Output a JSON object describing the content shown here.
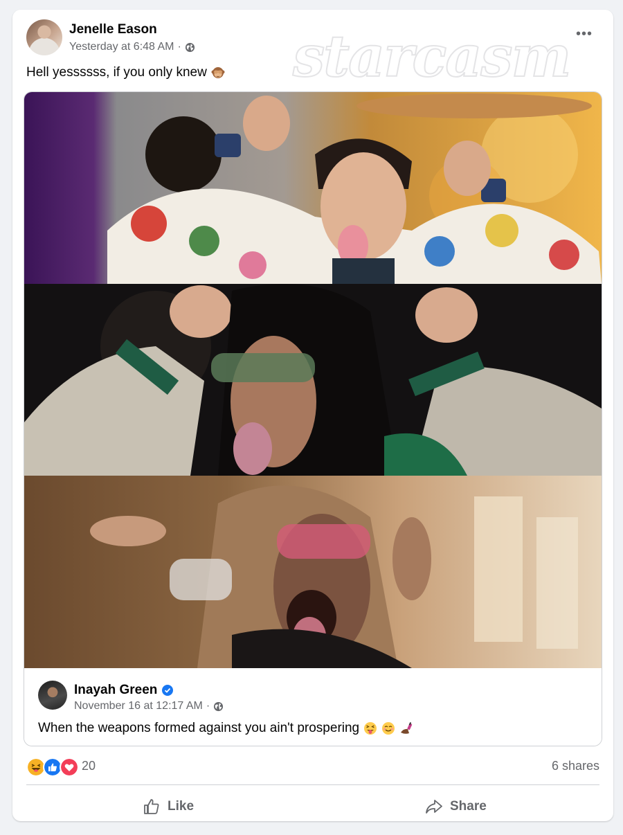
{
  "post": {
    "author": "Jenelle Eason",
    "timestamp": "Yesterday at 6:48 AM",
    "privacy_icon": "globe-icon",
    "more_label": "•••",
    "watermark": "starcasm",
    "text": "Hell yessssss, if you only knew",
    "text_emoji": "see-no-evil-monkey"
  },
  "shared_post": {
    "author": "Inayah Green",
    "verified": true,
    "timestamp": "November 16 at 12:17 AM",
    "privacy_icon": "globe-icon",
    "text": "When the weapons formed against you ain't prospering",
    "text_emojis": [
      "squinting-tongue-face",
      "smiling-face",
      "nail-polish"
    ],
    "images": [
      "performer-tongue-out-floral-jacket",
      "performer-green-sunglasses-tongue-out",
      "performer-pink-sunglasses-tongue-out"
    ]
  },
  "reactions": {
    "types": [
      "haha",
      "like",
      "love"
    ],
    "count": "20",
    "shares": "6 shares"
  },
  "actions": {
    "like": "Like",
    "share": "Share"
  },
  "colors": {
    "like_blue": "#1877f2",
    "love_red": "#f33e58",
    "haha_yellow": "#f7b125",
    "secondary_text": "#65676b"
  }
}
